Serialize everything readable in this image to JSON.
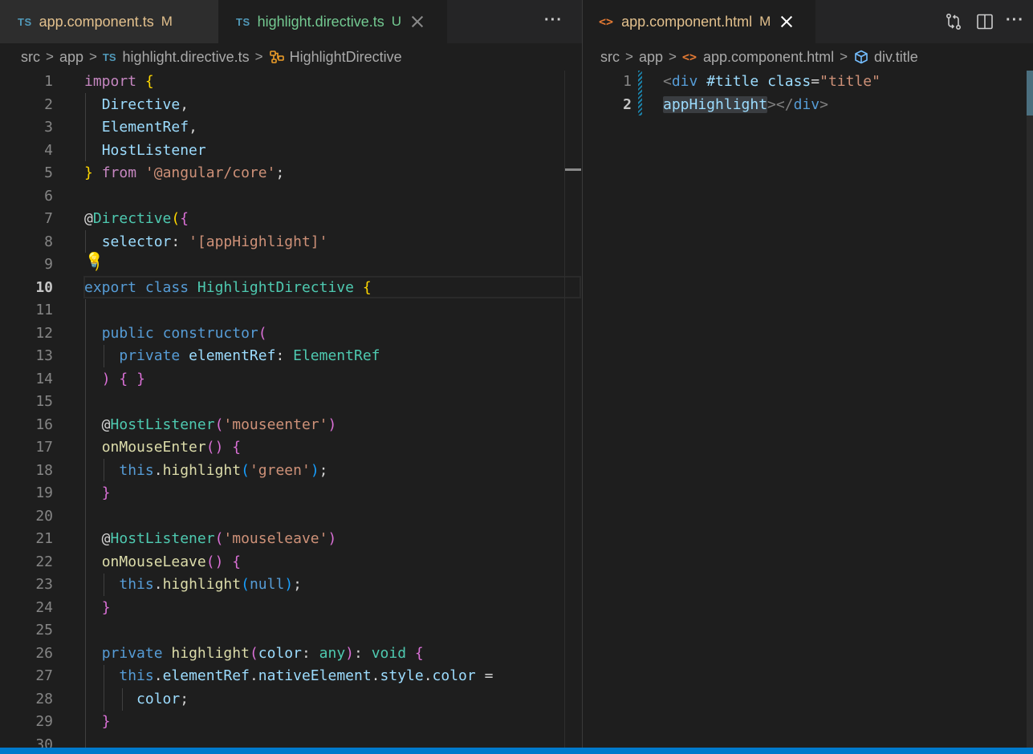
{
  "left_editor": {
    "tabs": [
      {
        "badge": "TS",
        "name": "app.component.ts",
        "flag": "M"
      },
      {
        "badge": "TS",
        "name": "highlight.directive.ts",
        "flag": "U"
      }
    ],
    "more_actions": "···",
    "breadcrumb": {
      "items": [
        "src",
        "app",
        "highlight.directive.ts",
        "HighlightDirective"
      ],
      "file_badge": "TS",
      "separator": ">"
    },
    "current_line": 10
  },
  "right_editor": {
    "tabs": [
      {
        "badge": "<>",
        "name": "app.component.html",
        "flag": "M"
      }
    ],
    "more_actions": "···",
    "breadcrumb": {
      "items": [
        "src",
        "app",
        "app.component.html",
        "div.title"
      ],
      "file_badge": "<>",
      "separator": ">"
    }
  },
  "icons": {
    "open_changes": "compare-changes-icon",
    "split_editor": "split-editor-icon",
    "lightbulb": "lightbulb-icon",
    "symbol_class": "class-symbol-icon",
    "symbol_element": "element-cube-icon"
  },
  "colors": {
    "editor_bg": "#1e1e1e",
    "tab_inactive_bg": "#2d2d2d",
    "modified": "#e2c08d",
    "untracked": "#73c991",
    "statusbar": "#007acc"
  }
}
